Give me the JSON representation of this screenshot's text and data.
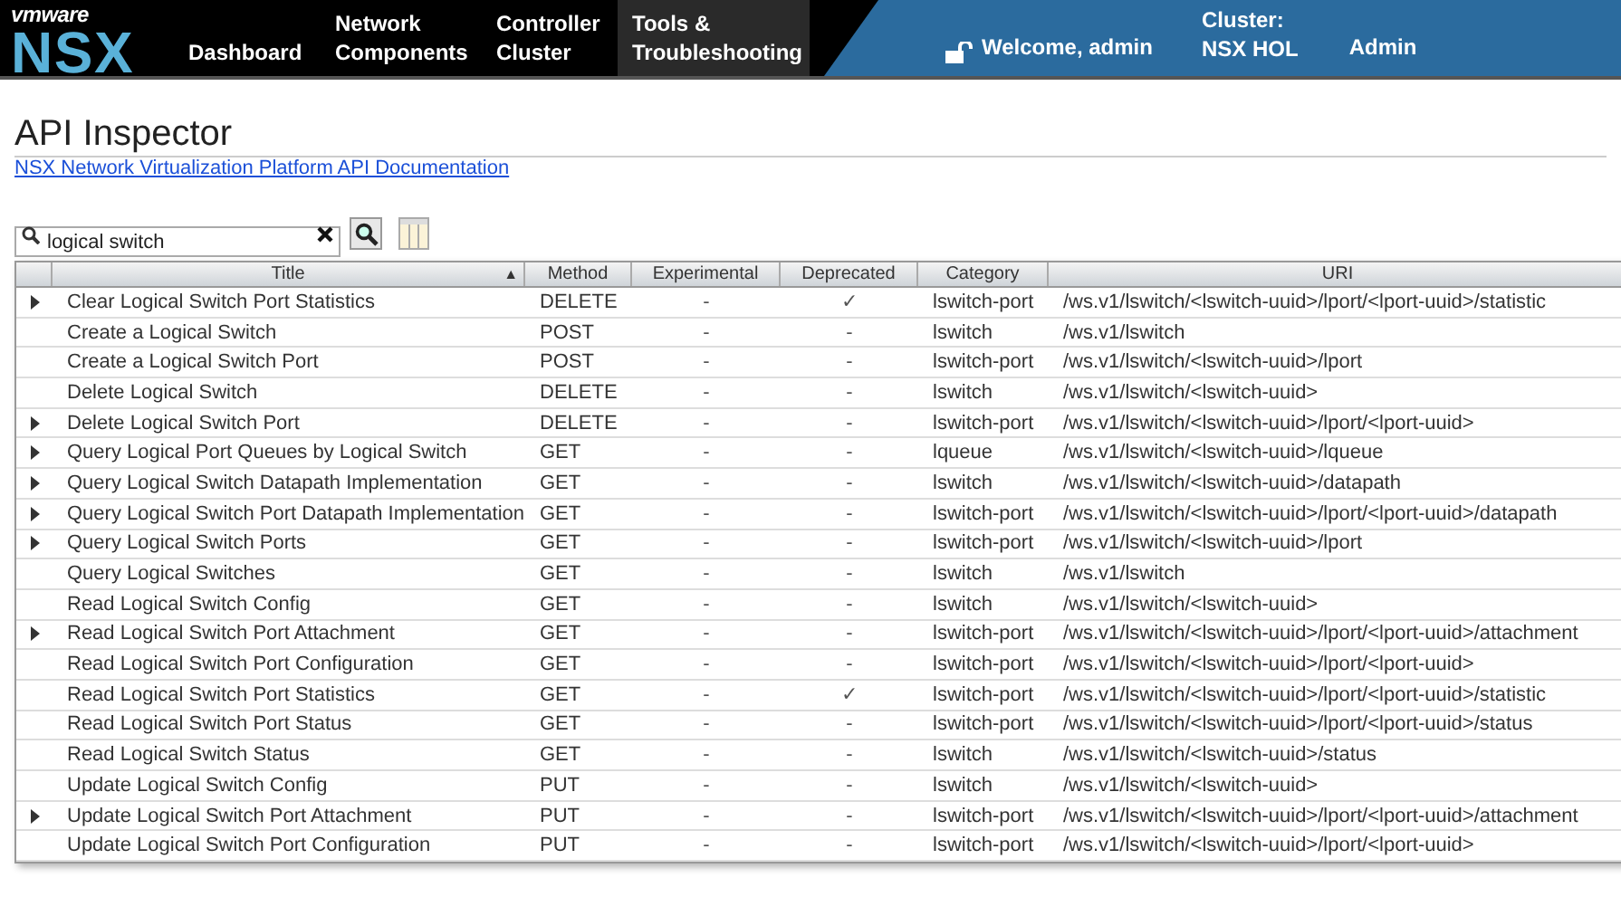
{
  "header": {
    "logo": {
      "brand": "vmware",
      "product": "NSX"
    },
    "nav": [
      {
        "label": "Dashboard",
        "selected": false
      },
      {
        "label": "Network\nComponents",
        "selected": false
      },
      {
        "label": "Controller\nCluster",
        "selected": false
      },
      {
        "label": "Tools &\nTroubleshooting",
        "selected": true
      }
    ],
    "user": "Welcome, admin",
    "cluster_label": "Cluster:",
    "cluster_name": "NSX HOL",
    "admin_menu": "Admin"
  },
  "page": {
    "title": "API Inspector",
    "doc_link": "NSX Network Virtualization Platform API Documentation"
  },
  "search": {
    "value": "logical switch"
  },
  "table": {
    "columns": [
      {
        "label": "Title",
        "sort": "▲"
      },
      {
        "label": "Method"
      },
      {
        "label": "Experimental"
      },
      {
        "label": "Deprecated"
      },
      {
        "label": "Category"
      },
      {
        "label": "URI"
      }
    ],
    "rows": [
      {
        "expandable": true,
        "title": "Clear Logical Switch Port Statistics",
        "method": "DELETE",
        "experimental": "-",
        "deprecated": "✓",
        "category": "lswitch-port",
        "uri": "/ws.v1/lswitch/<lswitch-uuid>/lport/<lport-uuid>/statistic"
      },
      {
        "expandable": false,
        "title": "Create a Logical Switch",
        "method": "POST",
        "experimental": "-",
        "deprecated": "-",
        "category": "lswitch",
        "uri": "/ws.v1/lswitch"
      },
      {
        "expandable": false,
        "title": "Create a Logical Switch Port",
        "method": "POST",
        "experimental": "-",
        "deprecated": "-",
        "category": "lswitch-port",
        "uri": "/ws.v1/lswitch/<lswitch-uuid>/lport"
      },
      {
        "expandable": false,
        "title": "Delete Logical Switch",
        "method": "DELETE",
        "experimental": "-",
        "deprecated": "-",
        "category": "lswitch",
        "uri": "/ws.v1/lswitch/<lswitch-uuid>"
      },
      {
        "expandable": true,
        "title": "Delete Logical Switch Port",
        "method": "DELETE",
        "experimental": "-",
        "deprecated": "-",
        "category": "lswitch-port",
        "uri": "/ws.v1/lswitch/<lswitch-uuid>/lport/<lport-uuid>"
      },
      {
        "expandable": true,
        "title": "Query Logical Port Queues by Logical Switch",
        "method": "GET",
        "experimental": "-",
        "deprecated": "-",
        "category": "lqueue",
        "uri": "/ws.v1/lswitch/<lswitch-uuid>/lqueue"
      },
      {
        "expandable": true,
        "title": "Query Logical Switch Datapath Implementation",
        "method": "GET",
        "experimental": "-",
        "deprecated": "-",
        "category": "lswitch",
        "uri": "/ws.v1/lswitch/<lswitch-uuid>/datapath"
      },
      {
        "expandable": true,
        "title": "Query Logical Switch Port Datapath Implementation",
        "method": "GET",
        "experimental": "-",
        "deprecated": "-",
        "category": "lswitch-port",
        "uri": "/ws.v1/lswitch/<lswitch-uuid>/lport/<lport-uuid>/datapath"
      },
      {
        "expandable": true,
        "title": "Query Logical Switch Ports",
        "method": "GET",
        "experimental": "-",
        "deprecated": "-",
        "category": "lswitch-port",
        "uri": "/ws.v1/lswitch/<lswitch-uuid>/lport"
      },
      {
        "expandable": false,
        "title": "Query Logical Switches",
        "method": "GET",
        "experimental": "-",
        "deprecated": "-",
        "category": "lswitch",
        "uri": "/ws.v1/lswitch"
      },
      {
        "expandable": false,
        "title": "Read Logical Switch Config",
        "method": "GET",
        "experimental": "-",
        "deprecated": "-",
        "category": "lswitch",
        "uri": "/ws.v1/lswitch/<lswitch-uuid>"
      },
      {
        "expandable": true,
        "title": "Read Logical Switch Port Attachment",
        "method": "GET",
        "experimental": "-",
        "deprecated": "-",
        "category": "lswitch-port",
        "uri": "/ws.v1/lswitch/<lswitch-uuid>/lport/<lport-uuid>/attachment"
      },
      {
        "expandable": false,
        "title": "Read Logical Switch Port Configuration",
        "method": "GET",
        "experimental": "-",
        "deprecated": "-",
        "category": "lswitch-port",
        "uri": "/ws.v1/lswitch/<lswitch-uuid>/lport/<lport-uuid>"
      },
      {
        "expandable": false,
        "title": "Read Logical Switch Port Statistics",
        "method": "GET",
        "experimental": "-",
        "deprecated": "✓",
        "category": "lswitch-port",
        "uri": "/ws.v1/lswitch/<lswitch-uuid>/lport/<lport-uuid>/statistic"
      },
      {
        "expandable": false,
        "title": "Read Logical Switch Port Status",
        "method": "GET",
        "experimental": "-",
        "deprecated": "-",
        "category": "lswitch-port",
        "uri": "/ws.v1/lswitch/<lswitch-uuid>/lport/<lport-uuid>/status"
      },
      {
        "expandable": false,
        "title": "Read Logical Switch Status",
        "method": "GET",
        "experimental": "-",
        "deprecated": "-",
        "category": "lswitch",
        "uri": "/ws.v1/lswitch/<lswitch-uuid>/status"
      },
      {
        "expandable": false,
        "title": "Update Logical Switch Config",
        "method": "PUT",
        "experimental": "-",
        "deprecated": "-",
        "category": "lswitch",
        "uri": "/ws.v1/lswitch/<lswitch-uuid>"
      },
      {
        "expandable": true,
        "title": "Update Logical Switch Port Attachment",
        "method": "PUT",
        "experimental": "-",
        "deprecated": "-",
        "category": "lswitch-port",
        "uri": "/ws.v1/lswitch/<lswitch-uuid>/lport/<lport-uuid>/attachment"
      },
      {
        "expandable": false,
        "title": "Update Logical Switch Port Configuration",
        "method": "PUT",
        "experimental": "-",
        "deprecated": "-",
        "category": "lswitch-port",
        "uri": "/ws.v1/lswitch/<lswitch-uuid>/lport/<lport-uuid>"
      }
    ]
  }
}
